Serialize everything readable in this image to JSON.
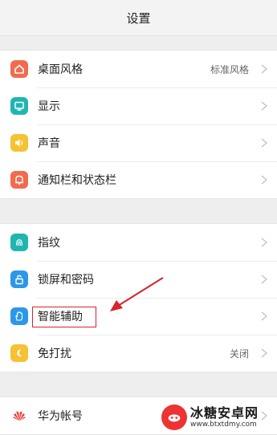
{
  "header": {
    "title": "设置"
  },
  "group1": {
    "items": [
      {
        "label": "桌面风格",
        "value": "标准风格",
        "icon": "home-icon",
        "color": "#f06b4f"
      },
      {
        "label": "显示",
        "value": "",
        "icon": "display-icon",
        "color": "#1fb6b0"
      },
      {
        "label": "声音",
        "value": "",
        "icon": "speaker-icon",
        "color": "#f6c234"
      },
      {
        "label": "通知栏和状态栏",
        "value": "",
        "icon": "bell-icon",
        "color": "#f06b4f"
      }
    ]
  },
  "group2": {
    "items": [
      {
        "label": "指纹",
        "value": "",
        "icon": "fingerprint-icon",
        "color": "#1fb6b0"
      },
      {
        "label": "锁屏和密码",
        "value": "",
        "icon": "lock-icon",
        "color": "#2d97e8"
      },
      {
        "label": "智能辅助",
        "value": "",
        "icon": "hand-icon",
        "color": "#2d97e8"
      },
      {
        "label": "免打扰",
        "value": "关闭",
        "icon": "moon-icon",
        "color": "#f6c234"
      }
    ]
  },
  "group3": {
    "items": [
      {
        "label": "华为帐号",
        "value": "",
        "icon": "huawei-logo-icon",
        "color": "#e8403a"
      }
    ]
  },
  "watermark": {
    "title": "冰糖安卓网",
    "url": "www.btxtdmy.com"
  }
}
